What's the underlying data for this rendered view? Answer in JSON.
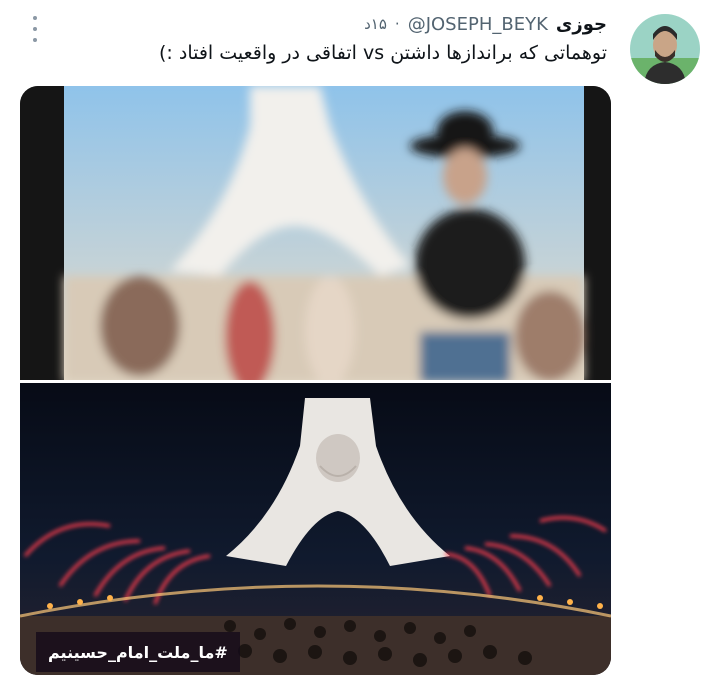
{
  "tweet": {
    "display_name": "جوزی",
    "handle": "@JOSEPH_BEYK",
    "separator": "·",
    "time": "۱۵د",
    "text": "توهماتی که براندازها داشتن vs اتفاقی در واقعیت افتاد :)"
  },
  "media": {
    "overlay_hashtag": "#ما_ملت_امام_حسینیم"
  },
  "icons": {
    "more": "more-vertical-icon"
  },
  "colors": {
    "text_primary": "#0f1419",
    "text_secondary": "#536471",
    "background": "#ffffff"
  }
}
